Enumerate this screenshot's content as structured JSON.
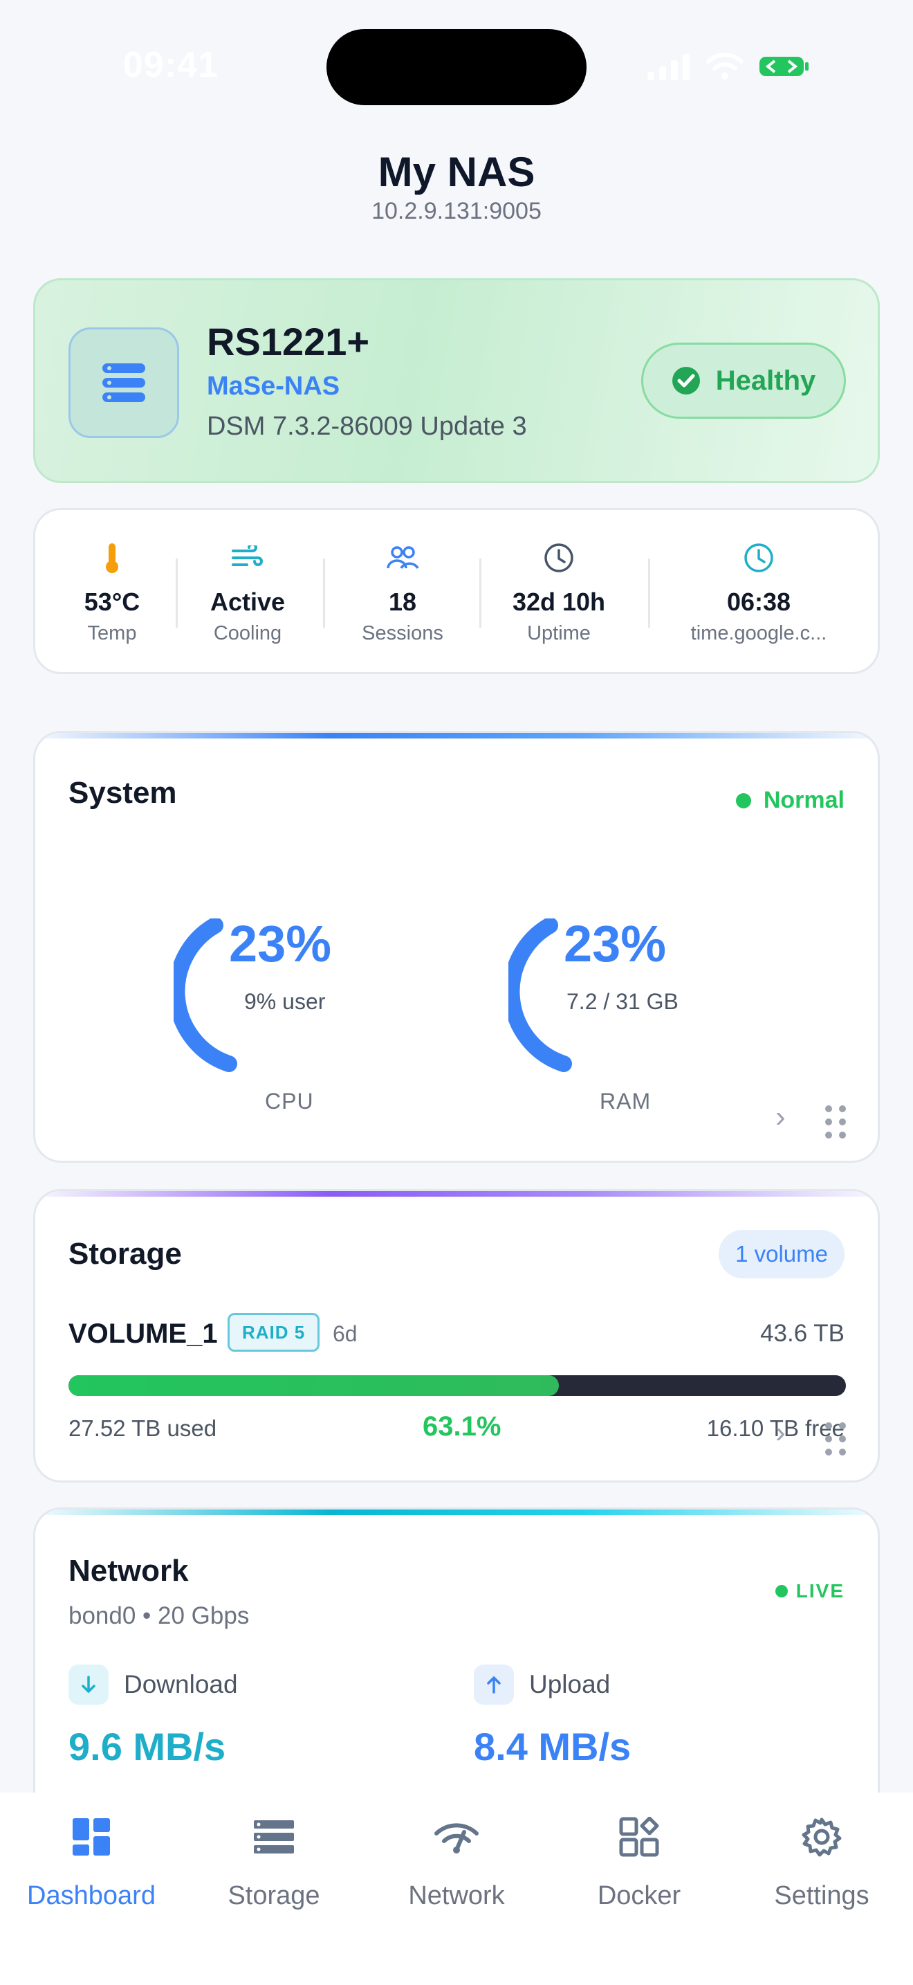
{
  "status_bar": {
    "time": "09:41"
  },
  "header": {
    "title": "My NAS",
    "address": "10.2.9.131:9005"
  },
  "device": {
    "model": "RS1221+",
    "hostname": "MaSe-NAS",
    "os_version": "DSM 7.3.2-86009 Update 3",
    "health": "Healthy"
  },
  "stats": [
    {
      "icon": "thermometer-icon",
      "value": "53°C",
      "label": "Temp"
    },
    {
      "icon": "fan-wind-icon",
      "value": "Active",
      "label": "Cooling"
    },
    {
      "icon": "users-icon",
      "value": "18",
      "label": "Sessions"
    },
    {
      "icon": "clock-icon",
      "value": "32d 10h",
      "label": "Uptime"
    },
    {
      "icon": "clock-icon",
      "value": "06:38",
      "label": "time.google.c..."
    }
  ],
  "system": {
    "title": "System",
    "status": "Normal",
    "cpu": {
      "percent": "23%",
      "detail": "9% user",
      "label": "CPU",
      "level": 0.23
    },
    "ram": {
      "percent": "23%",
      "detail": "7.2 / 31 GB",
      "label": "RAM",
      "level": 0.23
    }
  },
  "storage": {
    "title": "Storage",
    "volume_count": "1 volume",
    "volume": {
      "name": "VOLUME_1",
      "raid": "RAID 5",
      "age": "6d",
      "size": "43.6 TB",
      "used": "27.52 TB used",
      "percent": "63.1%",
      "free": "16.10 TB free",
      "fill": 0.631
    }
  },
  "network": {
    "title": "Network",
    "interface": "bond0 • 20 Gbps",
    "live": "LIVE",
    "download": {
      "label": "Download",
      "value": "9.6 MB/s"
    },
    "upload": {
      "label": "Upload",
      "value": "8.4 MB/s"
    }
  },
  "tabs": [
    {
      "label": "Dashboard",
      "icon": "dashboard-icon",
      "active": true
    },
    {
      "label": "Storage",
      "icon": "storage-icon",
      "active": false
    },
    {
      "label": "Network",
      "icon": "network-icon",
      "active": false
    },
    {
      "label": "Docker",
      "icon": "docker-icon",
      "active": false
    },
    {
      "label": "Settings",
      "icon": "settings-icon",
      "active": false
    }
  ],
  "colors": {
    "accent": "#3b82f6",
    "success": "#22c55e",
    "cyan": "#1faec9",
    "bar_track": "#262a38"
  }
}
